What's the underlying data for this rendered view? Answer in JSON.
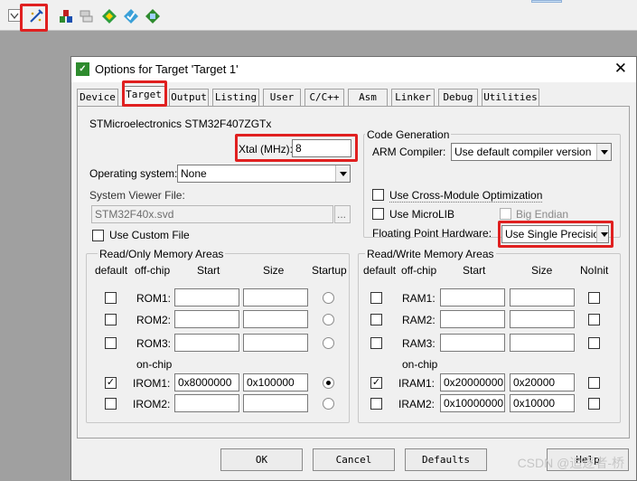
{
  "toolbar": {
    "icons": [
      "options-for-target-icon",
      "load-icon",
      "manage-project-items-icon",
      "select-packs-icon",
      "manage-run-time-environment-icon",
      "pack-installer-icon"
    ]
  },
  "dialog": {
    "title": "Options for Target 'Target 1'",
    "close": "✕",
    "tabs": [
      "Device",
      "Target",
      "Output",
      "Listing",
      "User",
      "C/C++",
      "Asm",
      "Linker",
      "Debug",
      "Utilities"
    ],
    "active_tab": "Target"
  },
  "target": {
    "device_name": "STMicroelectronics STM32F407ZGTx",
    "xtal_label": "Xtal (MHz):",
    "xtal_value": "8",
    "os_label": "Operating system:",
    "os_value": "None",
    "svd_label": "System Viewer File:",
    "svd_value": "STM32F40x.svd",
    "browse": "...",
    "custom_file_label": "Use Custom File"
  },
  "code_gen": {
    "title": "Code Generation",
    "arm_compiler_label": "ARM Compiler:",
    "arm_compiler_value": "Use default compiler version",
    "cross_module_label": "Use Cross-Module Optimization",
    "microlib_label": "Use MicroLIB",
    "big_endian_label": "Big Endian",
    "fph_label": "Floating Point Hardware:",
    "fph_value": "Use Single Precision"
  },
  "ro_mem": {
    "title": "Read/Only Memory Areas",
    "headers": {
      "default": "default",
      "offchip": "off-chip",
      "start": "Start",
      "size": "Size",
      "startup": "Startup"
    },
    "onchip_label": "on-chip",
    "rows": [
      {
        "label": "ROM1:",
        "start": "",
        "size": "",
        "default": false,
        "startup": false
      },
      {
        "label": "ROM2:",
        "start": "",
        "size": "",
        "default": false,
        "startup": false
      },
      {
        "label": "ROM3:",
        "start": "",
        "size": "",
        "default": false,
        "startup": false
      },
      {
        "label": "IROM1:",
        "start": "0x8000000",
        "size": "0x100000",
        "default": true,
        "startup": true
      },
      {
        "label": "IROM2:",
        "start": "",
        "size": "",
        "default": false,
        "startup": false
      }
    ]
  },
  "rw_mem": {
    "title": "Read/Write Memory Areas",
    "headers": {
      "default": "default",
      "offchip": "off-chip",
      "start": "Start",
      "size": "Size",
      "noinit": "NoInit"
    },
    "onchip_label": "on-chip",
    "rows": [
      {
        "label": "RAM1:",
        "start": "",
        "size": "",
        "default": false,
        "noinit": false
      },
      {
        "label": "RAM2:",
        "start": "",
        "size": "",
        "default": false,
        "noinit": false
      },
      {
        "label": "RAM3:",
        "start": "",
        "size": "",
        "default": false,
        "noinit": false
      },
      {
        "label": "IRAM1:",
        "start": "0x20000000",
        "size": "0x20000",
        "default": true,
        "noinit": false
      },
      {
        "label": "IRAM2:",
        "start": "0x10000000",
        "size": "0x10000",
        "default": false,
        "noinit": false
      }
    ]
  },
  "buttons": {
    "ok": "OK",
    "cancel": "Cancel",
    "defaults": "Defaults",
    "help": "Help"
  },
  "watermark": "CSDN @追逐者-桥",
  "colors": {
    "highlight": "#e02020",
    "title_bg": "#ffffff",
    "dialog_bg": "#f0f0f0"
  }
}
